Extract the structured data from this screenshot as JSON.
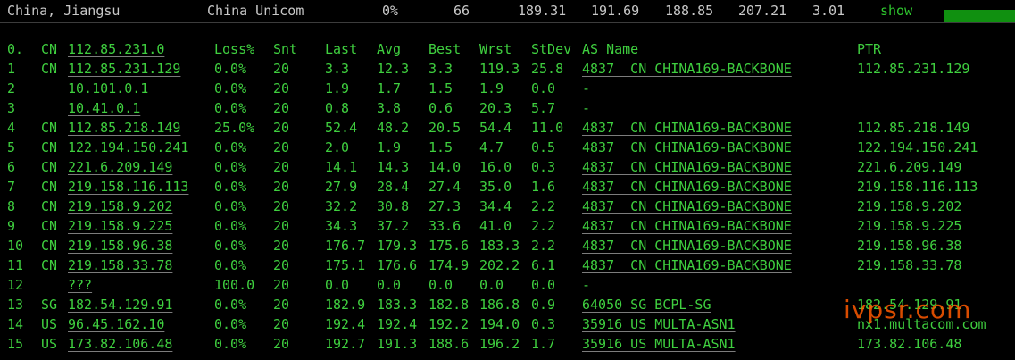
{
  "summary": {
    "location": "China, Jiangsu",
    "isp": "China Unicom",
    "loss": "0%",
    "sent": "66",
    "last": "189.31",
    "avg": "191.69",
    "best": "188.85",
    "worst": "207.21",
    "stdev": "3.01",
    "show_label": "show"
  },
  "headers": {
    "hop": "0.",
    "cc": "CN",
    "host": "112.85.231.0",
    "loss": "Loss%",
    "snt": "Snt",
    "last": "Last",
    "avg": "Avg",
    "best": "Best",
    "wrst": "Wrst",
    "stdev": "StDev",
    "asname": "AS Name",
    "ptr": "PTR"
  },
  "rows": [
    {
      "hop": "1",
      "cc": "CN",
      "host": "112.85.231.129",
      "loss": "0.0%",
      "snt": "20",
      "last": "3.3",
      "avg": "12.3",
      "best": "3.3",
      "wrst": "119.3",
      "stdev": "25.8",
      "asname": "4837  CN CHINA169-BACKBONE",
      "ptr": "112.85.231.129"
    },
    {
      "hop": "2",
      "cc": "",
      "host": "10.101.0.1",
      "loss": "0.0%",
      "snt": "20",
      "last": "1.9",
      "avg": "1.7",
      "best": "1.5",
      "wrst": "1.9",
      "stdev": "0.0",
      "asname": "-",
      "ptr": ""
    },
    {
      "hop": "3",
      "cc": "",
      "host": "10.41.0.1",
      "loss": "0.0%",
      "snt": "20",
      "last": "0.8",
      "avg": "3.8",
      "best": "0.6",
      "wrst": "20.3",
      "stdev": "5.7",
      "asname": "-",
      "ptr": ""
    },
    {
      "hop": "4",
      "cc": "CN",
      "host": "112.85.218.149",
      "loss": "25.0%",
      "snt": "20",
      "last": "52.4",
      "avg": "48.2",
      "best": "20.5",
      "wrst": "54.4",
      "stdev": "11.0",
      "asname": "4837  CN CHINA169-BACKBONE",
      "ptr": "112.85.218.149"
    },
    {
      "hop": "5",
      "cc": "CN",
      "host": "122.194.150.241",
      "loss": "0.0%",
      "snt": "20",
      "last": "2.0",
      "avg": "1.9",
      "best": "1.5",
      "wrst": "4.7",
      "stdev": "0.5",
      "asname": "4837  CN CHINA169-BACKBONE",
      "ptr": "122.194.150.241"
    },
    {
      "hop": "6",
      "cc": "CN",
      "host": "221.6.209.149",
      "loss": "0.0%",
      "snt": "20",
      "last": "14.1",
      "avg": "14.3",
      "best": "14.0",
      "wrst": "16.0",
      "stdev": "0.3",
      "asname": "4837  CN CHINA169-BACKBONE",
      "ptr": "221.6.209.149"
    },
    {
      "hop": "7",
      "cc": "CN",
      "host": "219.158.116.113",
      "loss": "0.0%",
      "snt": "20",
      "last": "27.9",
      "avg": "28.4",
      "best": "27.4",
      "wrst": "35.0",
      "stdev": "1.6",
      "asname": "4837  CN CHINA169-BACKBONE",
      "ptr": "219.158.116.113"
    },
    {
      "hop": "8",
      "cc": "CN",
      "host": "219.158.9.202",
      "loss": "0.0%",
      "snt": "20",
      "last": "32.2",
      "avg": "30.8",
      "best": "27.3",
      "wrst": "34.4",
      "stdev": "2.2",
      "asname": "4837  CN CHINA169-BACKBONE",
      "ptr": "219.158.9.202"
    },
    {
      "hop": "9",
      "cc": "CN",
      "host": "219.158.9.225",
      "loss": "0.0%",
      "snt": "20",
      "last": "34.3",
      "avg": "37.2",
      "best": "33.6",
      "wrst": "41.0",
      "stdev": "2.2",
      "asname": "4837  CN CHINA169-BACKBONE",
      "ptr": "219.158.9.225"
    },
    {
      "hop": "10",
      "cc": "CN",
      "host": "219.158.96.38",
      "loss": "0.0%",
      "snt": "20",
      "last": "176.7",
      "avg": "179.3",
      "best": "175.6",
      "wrst": "183.3",
      "stdev": "2.2",
      "asname": "4837  CN CHINA169-BACKBONE",
      "ptr": "219.158.96.38"
    },
    {
      "hop": "11",
      "cc": "CN",
      "host": "219.158.33.78",
      "loss": "0.0%",
      "snt": "20",
      "last": "175.1",
      "avg": "176.6",
      "best": "174.9",
      "wrst": "202.2",
      "stdev": "6.1",
      "asname": "4837  CN CHINA169-BACKBONE",
      "ptr": "219.158.33.78"
    },
    {
      "hop": "12",
      "cc": "",
      "host": "???",
      "loss": "100.0",
      "snt": "20",
      "last": "0.0",
      "avg": "0.0",
      "best": "0.0",
      "wrst": "0.0",
      "stdev": "0.0",
      "asname": "-",
      "ptr": ""
    },
    {
      "hop": "13",
      "cc": "SG",
      "host": "182.54.129.91",
      "loss": "0.0%",
      "snt": "20",
      "last": "182.9",
      "avg": "183.3",
      "best": "182.8",
      "wrst": "186.8",
      "stdev": "0.9",
      "asname": "64050 SG BCPL-SG",
      "ptr": "182.54.129.91"
    },
    {
      "hop": "14",
      "cc": "US",
      "host": "96.45.162.10",
      "loss": "0.0%",
      "snt": "20",
      "last": "192.4",
      "avg": "192.4",
      "best": "192.2",
      "wrst": "194.0",
      "stdev": "0.3",
      "asname": "35916 US MULTA-ASN1",
      "ptr": "nx1.multacom.com"
    },
    {
      "hop": "15",
      "cc": "US",
      "host": "173.82.106.48",
      "loss": "0.0%",
      "snt": "20",
      "last": "192.7",
      "avg": "191.3",
      "best": "188.6",
      "wrst": "196.2",
      "stdev": "1.7",
      "asname": "35916 US MULTA-ASN1",
      "ptr": "173.82.106.48"
    }
  ],
  "watermark": "ivpsr.com",
  "colors": {
    "text_green": "#3fcf3f",
    "show_green": "#2ec52e",
    "bar_green": "#109010",
    "watermark": "#ff5a00"
  }
}
